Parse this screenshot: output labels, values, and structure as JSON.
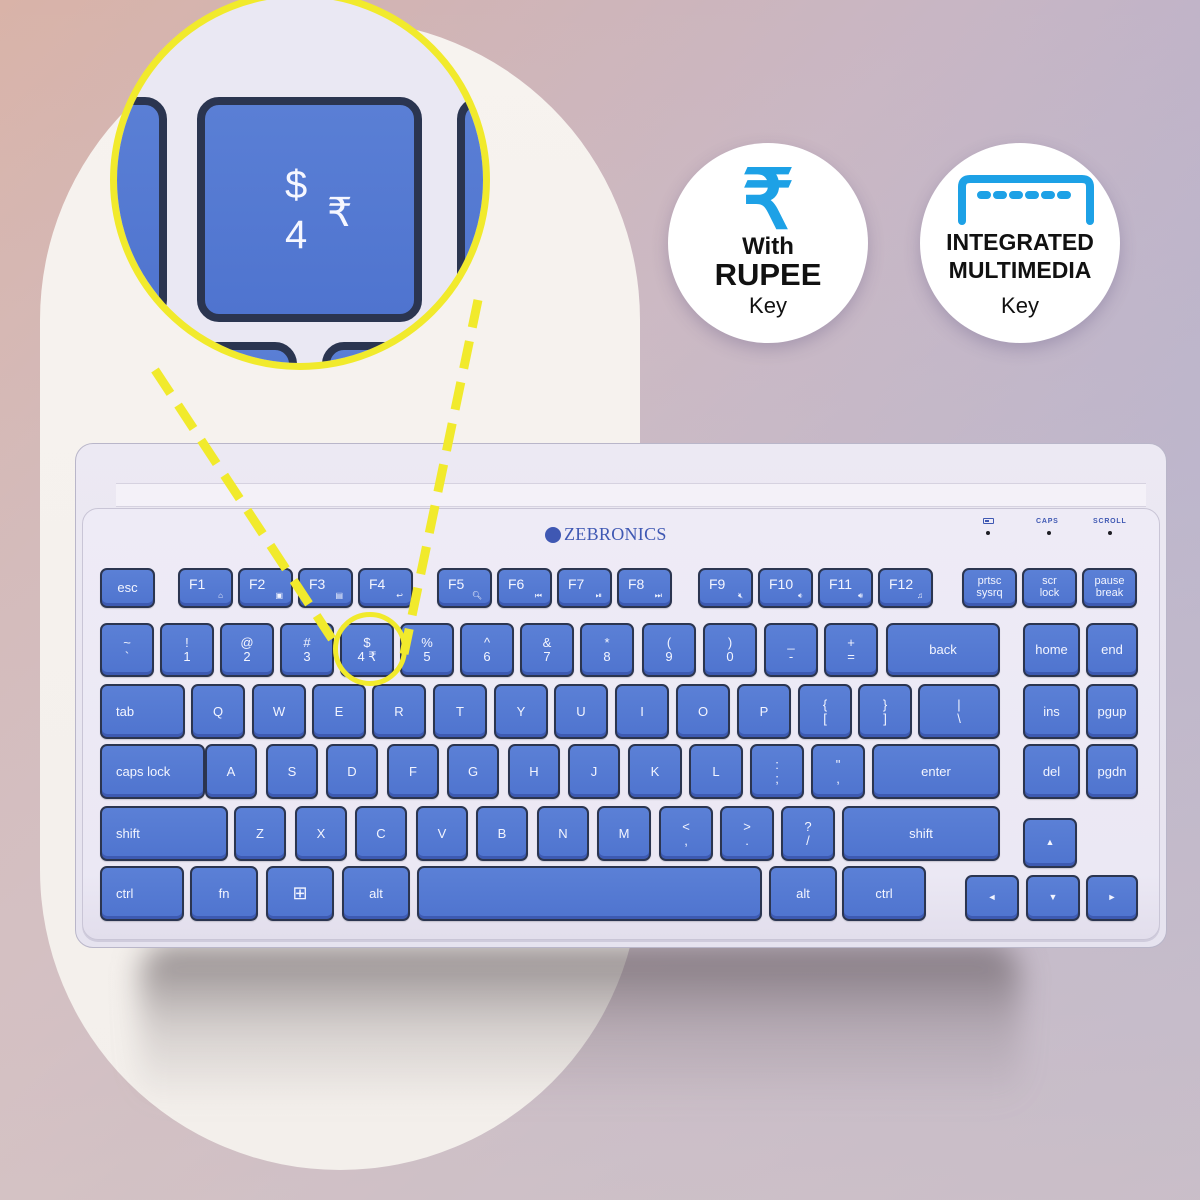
{
  "colors": {
    "accent_yellow": "#f1ea2c",
    "key_blue": "#5277d1",
    "brand_blue": "#3f58b3",
    "icon_blue": "#1da1e6"
  },
  "badges": {
    "rupee": {
      "icon": "rupee-icon",
      "glyph": "₹",
      "line1": "With",
      "line2": "RUPEE",
      "line3": "Key"
    },
    "multimedia": {
      "icon": "multimedia-bar-icon",
      "line1": "INTEGRATED",
      "line2": "MULTIMEDIA",
      "line3": "Key"
    }
  },
  "callout": {
    "top": "$",
    "bottom": "4",
    "rupee": "₹"
  },
  "keyboard": {
    "brand": "ZEBRONICS",
    "indicators": {
      "battery": "battery-icon",
      "caps": "CAPS",
      "scroll": "SCROLL"
    },
    "keys": {
      "esc": "esc",
      "f1": "F1",
      "f1_sub": "⌂",
      "f2": "F2",
      "f2_sub": "▣",
      "f3": "F3",
      "f3_sub": "▤",
      "f4": "F4",
      "f4_sub": "↩",
      "f5": "F5",
      "f5_sub": "🔍︎",
      "f6": "F6",
      "f6_sub": "⏮",
      "f7": "F7",
      "f7_sub": "⏯",
      "f8": "F8",
      "f8_sub": "⏭",
      "f9": "F9",
      "f9_sub": "🔇︎",
      "f10": "F10",
      "f10_sub": "🔉︎",
      "f11": "F11",
      "f11_sub": "🔊︎",
      "f12": "F12",
      "f12_sub": "♫",
      "prtsc": "prtsc\nsysrq",
      "scrlock": "scr\nlock",
      "pause": "pause\nbreak",
      "tilde": "~\n`",
      "k1": "!\n1",
      "k2": "@\n2",
      "k3": "#\n3",
      "k4": "$\n4 ₹",
      "k5": "%\n5",
      "k6": "^\n6",
      "k7": "&\n7",
      "k8": "*\n8",
      "k9": "(\n9",
      "k0": ")\n0",
      "minus": "_\n-",
      "equal": "+\n=",
      "back": "back",
      "home": "home",
      "end": "end",
      "tab": "tab",
      "q": "Q",
      "w": "W",
      "e": "E",
      "r": "R",
      "t": "T",
      "y": "Y",
      "u": "U",
      "i": "I",
      "o": "O",
      "p": "P",
      "lbracket": "{\n[",
      "rbracket": "}\n]",
      "backslash": "|\n\\",
      "ins": "ins",
      "pgup": "pgup",
      "caps": "caps lock",
      "a": "A",
      "s": "S",
      "d": "D",
      "f": "F",
      "g": "G",
      "h": "H",
      "j": "J",
      "k": "K",
      "l": "L",
      "semicolon": ":\n;",
      "quote": "\"\n,",
      "enter": "enter",
      "del": "del",
      "pgdn": "pgdn",
      "lshift": "shift",
      "z": "Z",
      "x": "X",
      "c": "C",
      "v": "V",
      "b": "B",
      "n": "N",
      "m": "M",
      "comma": "<\n,",
      "period": ">\n.",
      "slash": "?\n/",
      "rshift": "shift",
      "up": "▲",
      "lctrl": "ctrl",
      "fn": "fn",
      "win": "⊞",
      "lalt": "alt",
      "space": "",
      "ralt": "alt",
      "rctrl": "ctrl",
      "left": "◄",
      "down": "▼",
      "right": "►"
    }
  }
}
